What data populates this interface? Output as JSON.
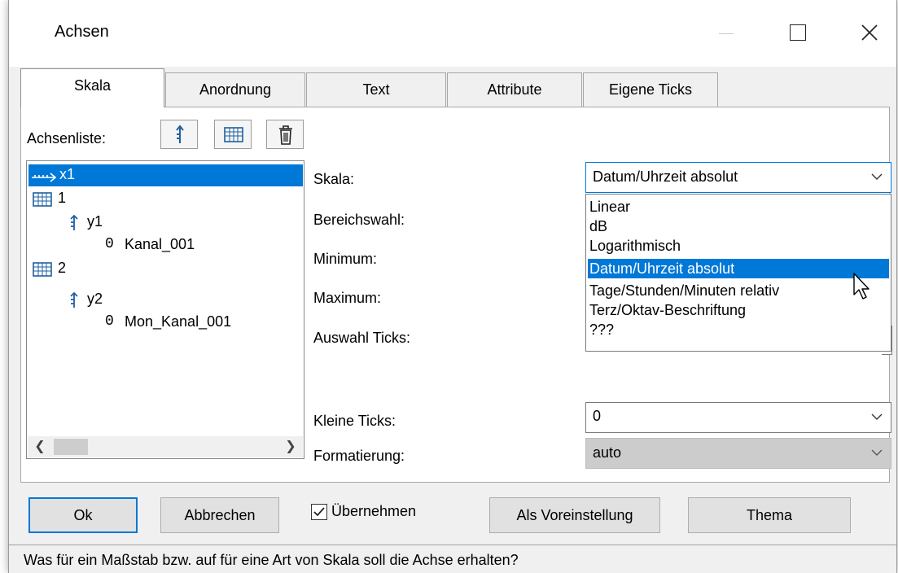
{
  "window": {
    "title": "Achsen"
  },
  "tabs": [
    {
      "label": "Skala"
    },
    {
      "label": "Anordnung"
    },
    {
      "label": "Text"
    },
    {
      "label": "Attribute"
    },
    {
      "label": "Eigene Ticks"
    }
  ],
  "axis_list": {
    "label": "Achsenliste:",
    "tools": [
      "axis-up-icon",
      "grid-icon",
      "trash-icon"
    ],
    "tree": [
      {
        "icon": "x-axis-arrow-icon",
        "text": "x1",
        "selected": true
      },
      {
        "icon": "grid-icon",
        "text": "1"
      },
      {
        "icon": "y-axis-icon",
        "text": "y1"
      },
      {
        "icon": "channel-icon",
        "glyph": "0",
        "text": "Kanal_001"
      },
      {
        "icon": "grid-icon",
        "text": "2"
      },
      {
        "icon": "y-axis-icon",
        "text": "y2"
      },
      {
        "icon": "channel-icon",
        "glyph": "0",
        "text": "Mon_Kanal_001"
      }
    ]
  },
  "fields": {
    "skala": {
      "label": "Skala:",
      "value": "Datum/Uhrzeit absolut"
    },
    "bereichswahl": {
      "label": "Bereichswahl:"
    },
    "minimum": {
      "label": "Minimum:"
    },
    "maximum": {
      "label": "Maximum:"
    },
    "auswahl_ticks": {
      "label": "Auswahl Ticks:"
    },
    "kleine_ticks": {
      "label": "Kleine Ticks:",
      "value": "0"
    },
    "formatierung": {
      "label": "Formatierung:",
      "value": "auto"
    }
  },
  "dropdown": {
    "options": [
      "Linear",
      "dB",
      "Logarithmisch",
      "Datum/Uhrzeit absolut",
      "Tage/Stunden/Minuten relativ",
      "Terz/Oktav-Beschriftung",
      "???"
    ],
    "selected": "Datum/Uhrzeit absolut"
  },
  "buttons": {
    "ok": "Ok",
    "cancel": "Abbrechen",
    "apply_label": "Übernehmen",
    "apply_checked": true,
    "preset": "Als Voreinstellung",
    "theme": "Thema"
  },
  "status": "Was für ein Maßstab bzw. auf für eine Art von Skala soll die Achse erhalten?",
  "colors": {
    "accent": "#0078d7",
    "icon_blue": "#1f5fa0"
  }
}
